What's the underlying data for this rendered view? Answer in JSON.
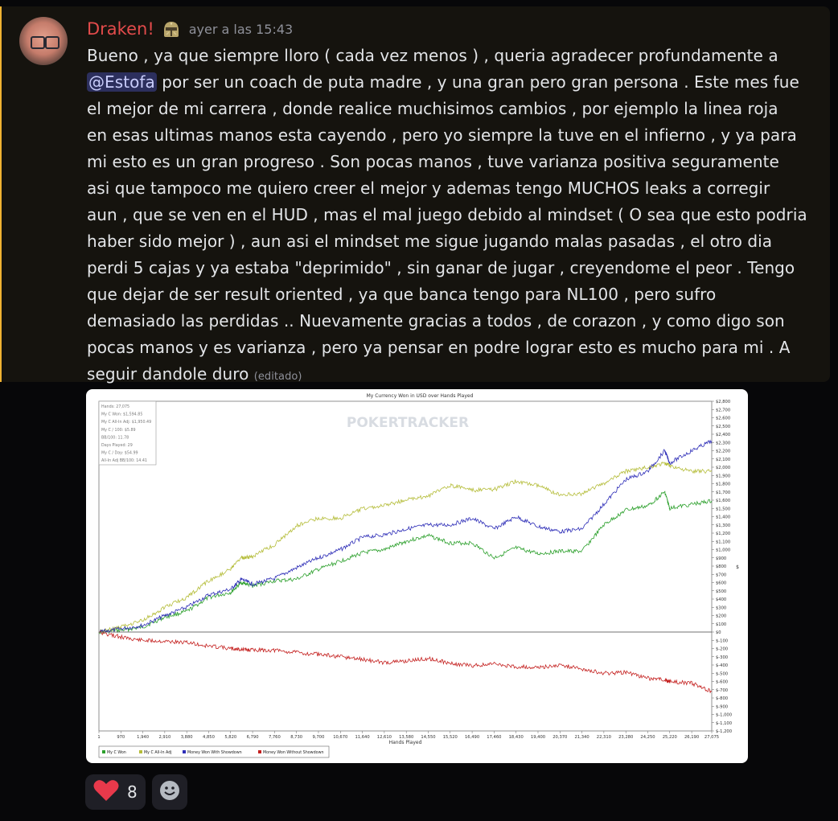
{
  "message": {
    "username": "Draken!",
    "timestamp": "ayer a las 15:43",
    "text_pre": "Bueno , ya que siempre lloro ( cada vez menos ) , queria agradecer profundamente a\n",
    "mention": "@Estofa",
    "text_post": " por ser un coach de puta madre , y una gran pero gran persona . Este mes fue\nel mejor de mi carrera ,  donde realice muchisimos cambios , por ejemplo la linea roja\nen esas ultimas manos esta cayendo , pero yo siempre la tuve en el infierno , y ya para\nmi esto es un gran progreso . Son pocas manos , tuve varianza positiva seguramente\nasi que tampoco me quiero creer el mejor y ademas tengo MUCHOS leaks a corregir\naun , que se ven en el HUD , mas el mal juego debido al mindset ( O sea que esto podria\nhaber sido mejor )  , aun asi el mindset me sigue jugando malas pasadas , el otro dia\nperdi 5 cajas y ya estaba \"deprimido\" , sin ganar de jugar , creyendome el peor . Tengo\nque dejar de ser result oriented , ya que banca tengo para NL100 , pero sufro\ndemasiado las perdidas .. Nuevamente gracias a todos , de corazon , y como digo son\npocas manos y es varianza , pero ya pensar en podre lograr esto es mucho para mi . A\nseguir dandole duro ",
    "edited_label": "(editado)"
  },
  "reactions": [
    {
      "icon": "heart-icon",
      "count": "8",
      "color": "#e8394b"
    }
  ],
  "chart": {
    "watermark": "POKERTRACKER",
    "stats": [
      "Hands: 27,075",
      "My C Won: $1,594.85",
      "My C All-In Adj: $1,950.49",
      "My C / 100: $5.89",
      "BB/100: 11.78",
      "Days Played: 29",
      "My C / Day: $54.99",
      "All-In Adj BB/100: 14.41"
    ]
  },
  "chart_data": {
    "type": "line",
    "title": "My Currency Won in USD over Hands Played",
    "xlabel": "Hands Played",
    "ylabel": "$",
    "xlim": [
      1,
      27075
    ],
    "ylim": [
      -1200,
      2800
    ],
    "x_ticks": [
      "1",
      "970",
      "1,940",
      "2,910",
      "3,880",
      "4,850",
      "5,820",
      "6,790",
      "7,760",
      "8,730",
      "9,700",
      "10,670",
      "11,640",
      "12,610",
      "13,580",
      "14,550",
      "15,520",
      "16,490",
      "17,460",
      "18,430",
      "19,400",
      "20,370",
      "21,340",
      "22,310",
      "23,280",
      "24,250",
      "25,220",
      "26,190",
      "27,075"
    ],
    "x_tick_values": [
      1,
      970,
      1940,
      2910,
      3880,
      4850,
      5820,
      6790,
      7760,
      8730,
      9700,
      10670,
      11640,
      12610,
      13580,
      14550,
      15520,
      16490,
      17460,
      18430,
      19400,
      20370,
      21340,
      22310,
      23280,
      24250,
      25220,
      26190,
      27075
    ],
    "y_ticks": [
      "$2,800",
      "$2,700",
      "$2,600",
      "$2,500",
      "$2,400",
      "$2,300",
      "$2,200",
      "$2,100",
      "$2,000",
      "$1,900",
      "$1,800",
      "$1,700",
      "$1,600",
      "$1,500",
      "$1,400",
      "$1,300",
      "$1,200",
      "$1,100",
      "$1,000",
      "$900",
      "$800",
      "$700",
      "$600",
      "$500",
      "$400",
      "$300",
      "$200",
      "$100",
      "$0",
      "$-100",
      "$-200",
      "$-300",
      "$-400",
      "$-500",
      "$-600",
      "$-700",
      "$-800",
      "$-900",
      "$-1,000",
      "$-1,100",
      "$-1,200"
    ],
    "y_tick_values": [
      2800,
      2700,
      2600,
      2500,
      2400,
      2300,
      2200,
      2100,
      2000,
      1900,
      1800,
      1700,
      1600,
      1500,
      1400,
      1300,
      1200,
      1100,
      1000,
      900,
      800,
      700,
      600,
      500,
      400,
      300,
      200,
      100,
      0,
      -100,
      -200,
      -300,
      -400,
      -500,
      -600,
      -700,
      -800,
      -900,
      -1000,
      -1100,
      -1200
    ],
    "x": [
      1,
      970,
      1940,
      2910,
      3880,
      4850,
      5820,
      6300,
      6790,
      7760,
      8730,
      9700,
      10670,
      11640,
      12610,
      13580,
      14550,
      15520,
      16490,
      17460,
      18430,
      19400,
      20370,
      21340,
      22310,
      23280,
      24250,
      25000,
      25220,
      26190,
      27075
    ],
    "series": [
      {
        "name": "My C Won",
        "color": "#2ca02c",
        "values": [
          0,
          20,
          60,
          180,
          250,
          420,
          480,
          600,
          560,
          620,
          640,
          760,
          860,
          960,
          1000,
          1100,
          1170,
          1080,
          1080,
          900,
          1020,
          950,
          980,
          980,
          1300,
          1480,
          1530,
          1700,
          1500,
          1550,
          1590
        ]
      },
      {
        "name": "My C All-In Adj",
        "color": "#b5bd3a",
        "values": [
          0,
          60,
          140,
          300,
          420,
          620,
          760,
          900,
          920,
          1060,
          1290,
          1380,
          1380,
          1500,
          1540,
          1600,
          1650,
          1780,
          1720,
          1730,
          1830,
          1780,
          1660,
          1680,
          1800,
          1950,
          2000,
          2050,
          2020,
          1950,
          1950
        ]
      },
      {
        "name": "Money Won With Showdown",
        "color": "#2d2db7",
        "values": [
          0,
          40,
          80,
          200,
          300,
          450,
          520,
          640,
          580,
          650,
          780,
          900,
          1000,
          1150,
          1180,
          1250,
          1300,
          1300,
          1380,
          1250,
          1400,
          1280,
          1220,
          1250,
          1550,
          1850,
          1950,
          2200,
          2050,
          2200,
          2320
        ]
      },
      {
        "name": "Money Won Without Showdown",
        "color": "#c4201f",
        "values": [
          0,
          -60,
          -100,
          -110,
          -130,
          -170,
          -200,
          -210,
          -220,
          -220,
          -250,
          -270,
          -300,
          -330,
          -370,
          -350,
          -320,
          -380,
          -410,
          -390,
          -420,
          -430,
          -400,
          -450,
          -500,
          -490,
          -560,
          -580,
          -600,
          -620,
          -720
        ]
      }
    ],
    "legend_position": "bottom-left",
    "grid": false
  }
}
